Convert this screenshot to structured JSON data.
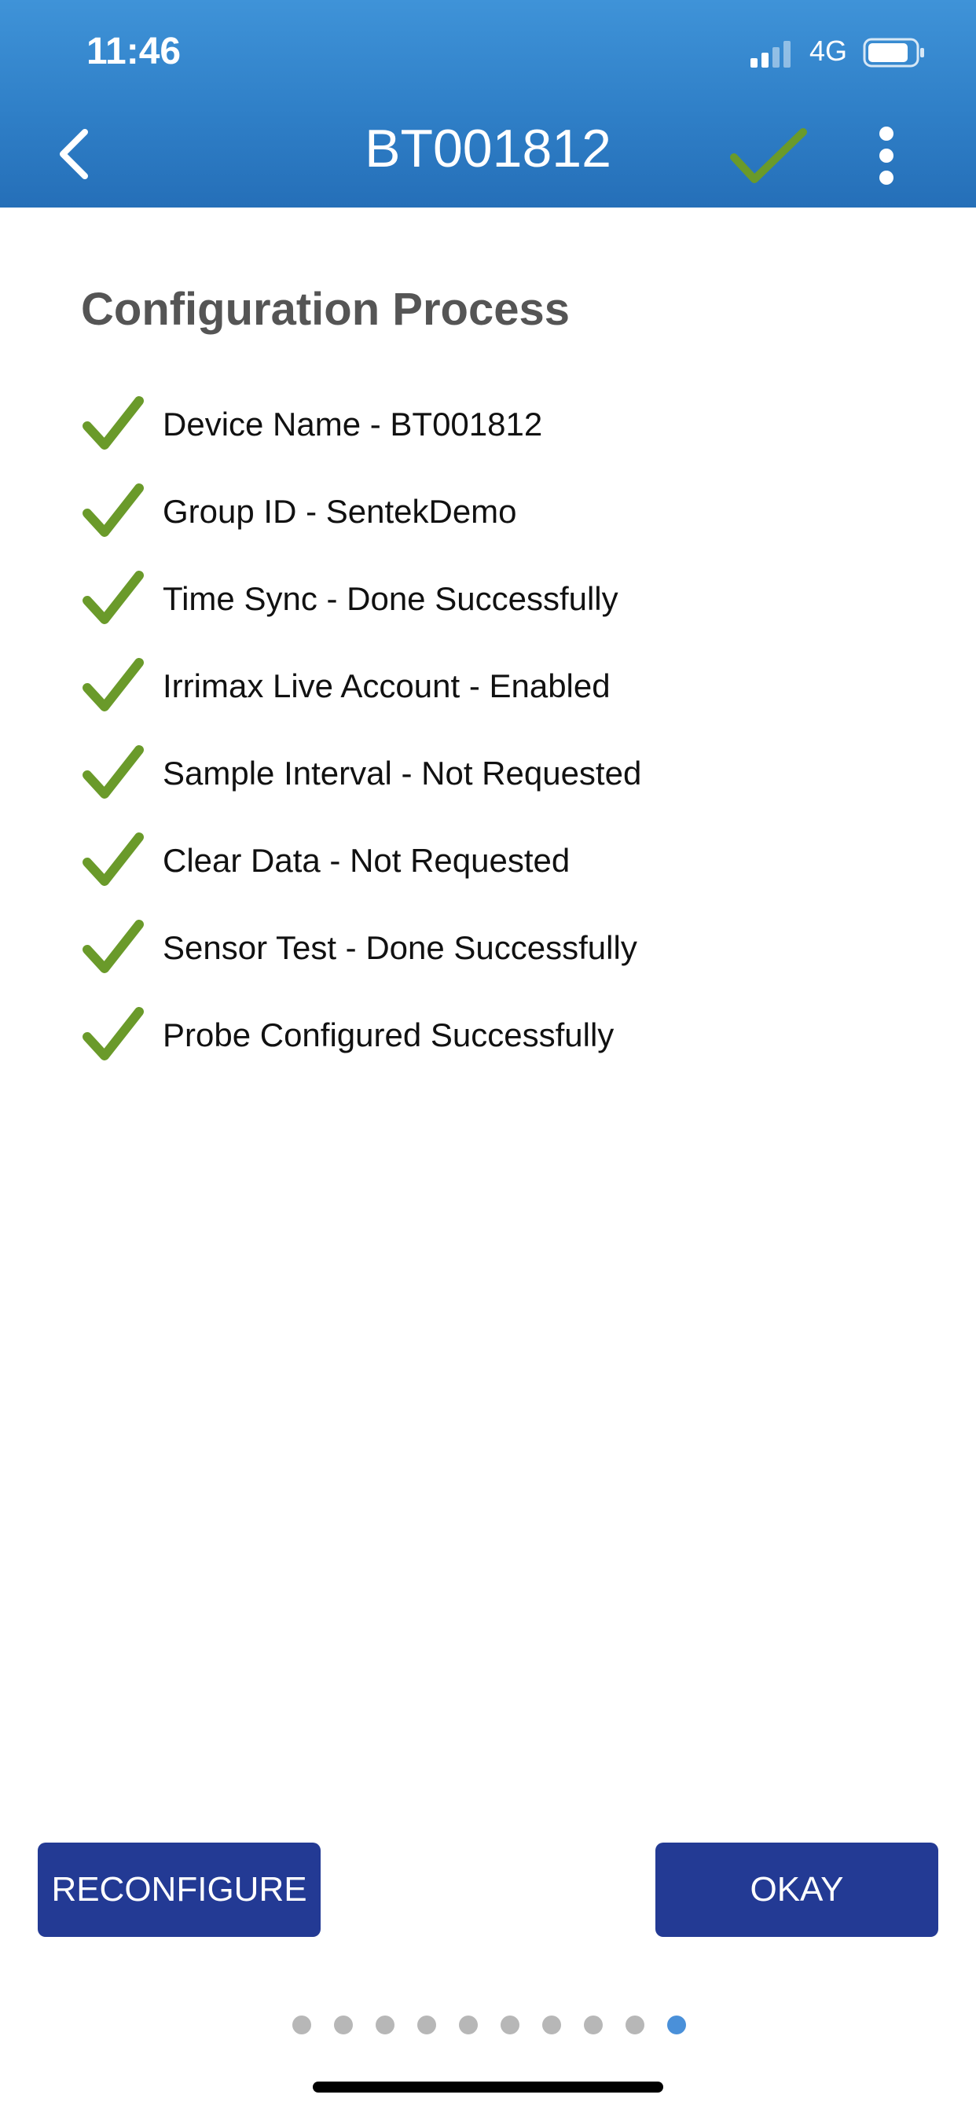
{
  "status_bar": {
    "time": "11:46",
    "network": "4G",
    "signal_icon": "signal-bars-icon",
    "battery_icon": "battery-icon"
  },
  "header": {
    "title": "BT001812",
    "back_icon": "chevron-left-icon",
    "confirm_icon": "checkmark-icon",
    "menu_icon": "more-vertical-icon"
  },
  "content": {
    "section_title": "Configuration Process",
    "steps": [
      {
        "label": "Device Name - BT001812",
        "icon": "checkmark-icon"
      },
      {
        "label": "Group ID - SentekDemo",
        "icon": "checkmark-icon"
      },
      {
        "label": "Time Sync - Done Successfully",
        "icon": "checkmark-icon"
      },
      {
        "label": "Irrimax Live Account - Enabled",
        "icon": "checkmark-icon"
      },
      {
        "label": "Sample Interval - Not Requested",
        "icon": "checkmark-icon"
      },
      {
        "label": "Clear Data - Not Requested",
        "icon": "checkmark-icon"
      },
      {
        "label": "Sensor Test - Done Successfully",
        "icon": "checkmark-icon"
      },
      {
        "label": "Probe Configured Successfully",
        "icon": "checkmark-icon"
      }
    ]
  },
  "actions": {
    "reconfigure_label": "RECONFIGURE",
    "okay_label": "OKAY"
  },
  "pager": {
    "total_pages": 10,
    "current_page": 10
  },
  "colors": {
    "header_blue": "#2f7fc7",
    "check_green": "#6a9a2a",
    "button_navy": "#233a94",
    "active_dot": "#4a90d9",
    "inactive_dot": "#b7b7b7"
  }
}
